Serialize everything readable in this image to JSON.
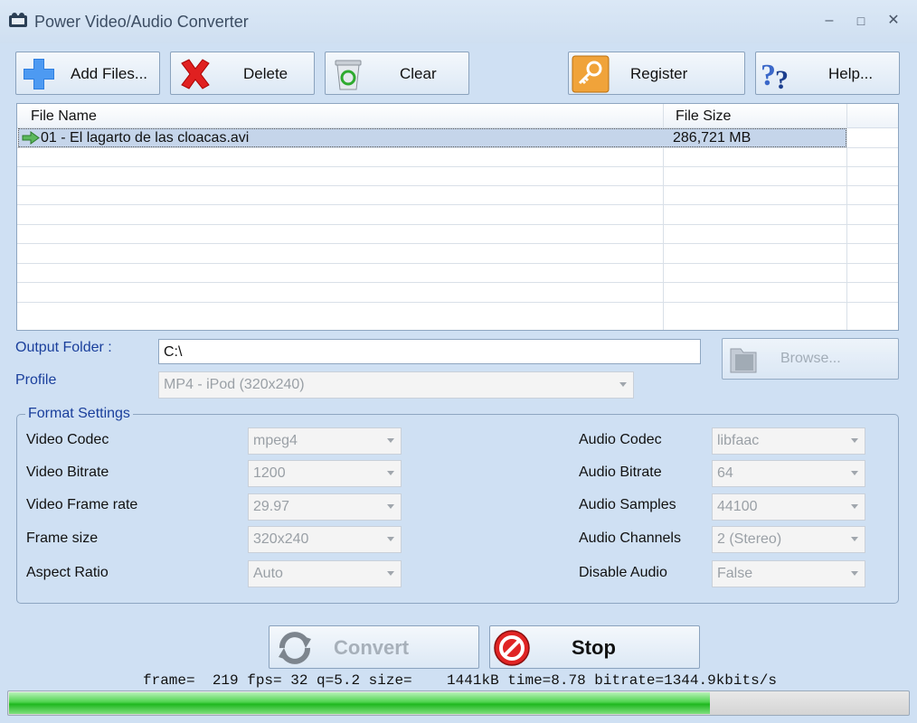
{
  "window": {
    "title": "Power Video/Audio Converter",
    "icon": "film-app-icon",
    "controls": {
      "minimize": "–",
      "maximize": "□",
      "close": "✕"
    }
  },
  "toolbar": {
    "add_files": "Add Files...",
    "delete": "Delete",
    "clear": "Clear",
    "register": "Register",
    "help": "Help..."
  },
  "file_list": {
    "columns": [
      "File Name",
      "File Size"
    ],
    "rows": [
      {
        "name": "01 - El lagarto de las cloacas.avi",
        "size": "286,721 MB",
        "selected": true
      }
    ]
  },
  "output": {
    "folder_label": "Output Folder :",
    "folder_value": "C:\\",
    "browse_label": "Browse...",
    "profile_label": "Profile",
    "profile_value": "MP4 - iPod (320x240)"
  },
  "format_settings": {
    "title": "Format Settings",
    "video": [
      {
        "label": "Video Codec",
        "value": "mpeg4"
      },
      {
        "label": "Video Bitrate",
        "value": "1200"
      },
      {
        "label": "Video Frame rate",
        "value": "29.97"
      },
      {
        "label": "Frame size",
        "value": "320x240"
      },
      {
        "label": "Aspect Ratio",
        "value": "Auto"
      }
    ],
    "audio": [
      {
        "label": "Audio Codec",
        "value": "libfaac"
      },
      {
        "label": "Audio Bitrate",
        "value": "64"
      },
      {
        "label": "Audio Samples",
        "value": "44100"
      },
      {
        "label": "Audio Channels",
        "value": "2 (Stereo)"
      },
      {
        "label": "Disable Audio",
        "value": "False"
      }
    ]
  },
  "actions": {
    "convert": "Convert",
    "stop": "Stop"
  },
  "status_line": "frame=  219 fps= 32 q=5.2 size=    1441kB time=8.78 bitrate=1344.9kbits/s",
  "progress": {
    "fraction": 0.78
  },
  "colors": {
    "accent_label": "#1a3f9c",
    "progress_green": "#1fb81f",
    "selection": "#c5d5ea"
  }
}
